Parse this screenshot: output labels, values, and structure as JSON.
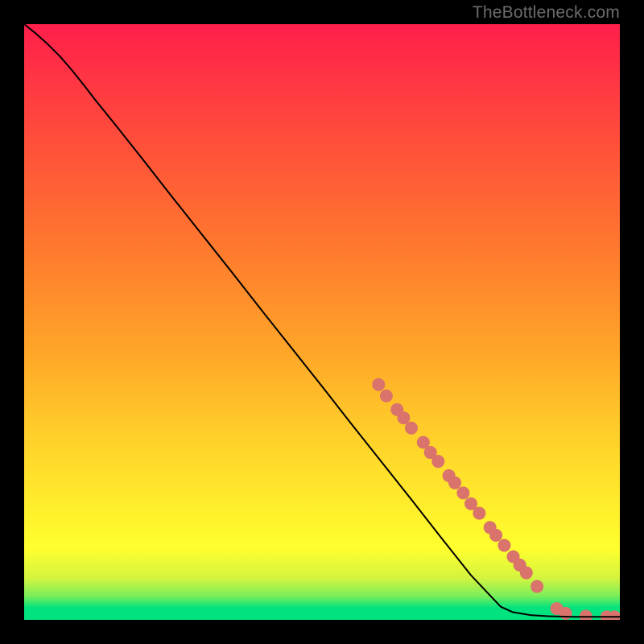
{
  "watermark": "TheBottleneck.com",
  "chart_data": {
    "type": "line",
    "title": "",
    "xlabel": "",
    "ylabel": "",
    "xlim": [
      0,
      100
    ],
    "ylim": [
      0,
      100
    ],
    "grid": false,
    "legend": false,
    "background_gradient": {
      "stops": [
        {
          "offset": 0.0,
          "color": "#00e37f"
        },
        {
          "offset": 0.02,
          "color": "#00e37f"
        },
        {
          "offset": 0.04,
          "color": "#7aee5a"
        },
        {
          "offset": 0.07,
          "color": "#d4f43f"
        },
        {
          "offset": 0.12,
          "color": "#ffff2e"
        },
        {
          "offset": 0.18,
          "color": "#fff02c"
        },
        {
          "offset": 0.3,
          "color": "#ffd22a"
        },
        {
          "offset": 0.45,
          "color": "#ffa628"
        },
        {
          "offset": 0.62,
          "color": "#ff7a2e"
        },
        {
          "offset": 0.8,
          "color": "#ff4f3a"
        },
        {
          "offset": 1.0,
          "color": "#ff1f4b"
        }
      ]
    },
    "curve": {
      "color": "#000000",
      "width": 2,
      "points": [
        {
          "x": 0,
          "y": 100
        },
        {
          "x": 2,
          "y": 98.4
        },
        {
          "x": 4,
          "y": 96.6
        },
        {
          "x": 6,
          "y": 94.6
        },
        {
          "x": 8,
          "y": 92.3
        },
        {
          "x": 10,
          "y": 89.8
        },
        {
          "x": 12,
          "y": 87.2
        },
        {
          "x": 15,
          "y": 83.5
        },
        {
          "x": 20,
          "y": 77.2
        },
        {
          "x": 25,
          "y": 70.8
        },
        {
          "x": 30,
          "y": 64.5
        },
        {
          "x": 35,
          "y": 58.2
        },
        {
          "x": 40,
          "y": 51.8
        },
        {
          "x": 45,
          "y": 45.5
        },
        {
          "x": 50,
          "y": 39.2
        },
        {
          "x": 55,
          "y": 32.8
        },
        {
          "x": 60,
          "y": 26.5
        },
        {
          "x": 65,
          "y": 20.2
        },
        {
          "x": 70,
          "y": 13.8
        },
        {
          "x": 75,
          "y": 7.5
        },
        {
          "x": 80,
          "y": 2.2
        },
        {
          "x": 82,
          "y": 1.3
        },
        {
          "x": 85,
          "y": 0.8
        },
        {
          "x": 88,
          "y": 0.6
        },
        {
          "x": 92,
          "y": 0.5
        },
        {
          "x": 96,
          "y": 0.5
        },
        {
          "x": 100,
          "y": 0.5
        }
      ]
    },
    "markers": {
      "color": "#d9736b",
      "radius": 8,
      "series": [
        {
          "x": 59.5,
          "y": 39.5
        },
        {
          "x": 60.8,
          "y": 37.6
        },
        {
          "x": 62.6,
          "y": 35.3
        },
        {
          "x": 63.7,
          "y": 33.9
        },
        {
          "x": 65.0,
          "y": 32.2
        },
        {
          "x": 67.0,
          "y": 29.8
        },
        {
          "x": 68.2,
          "y": 28.1
        },
        {
          "x": 69.5,
          "y": 26.6
        },
        {
          "x": 71.3,
          "y": 24.2
        },
        {
          "x": 72.3,
          "y": 23.0
        },
        {
          "x": 73.7,
          "y": 21.3
        },
        {
          "x": 75.0,
          "y": 19.5
        },
        {
          "x": 76.4,
          "y": 17.9
        },
        {
          "x": 78.2,
          "y": 15.5
        },
        {
          "x": 79.2,
          "y": 14.2
        },
        {
          "x": 80.6,
          "y": 12.5
        },
        {
          "x": 82.1,
          "y": 10.6
        },
        {
          "x": 83.2,
          "y": 9.2
        },
        {
          "x": 84.3,
          "y": 7.9
        },
        {
          "x": 86.1,
          "y": 5.6
        },
        {
          "x": 89.4,
          "y": 1.9
        },
        {
          "x": 90.9,
          "y": 1.1
        },
        {
          "x": 94.3,
          "y": 0.6
        },
        {
          "x": 97.8,
          "y": 0.5
        },
        {
          "x": 99.1,
          "y": 0.5
        }
      ]
    }
  }
}
